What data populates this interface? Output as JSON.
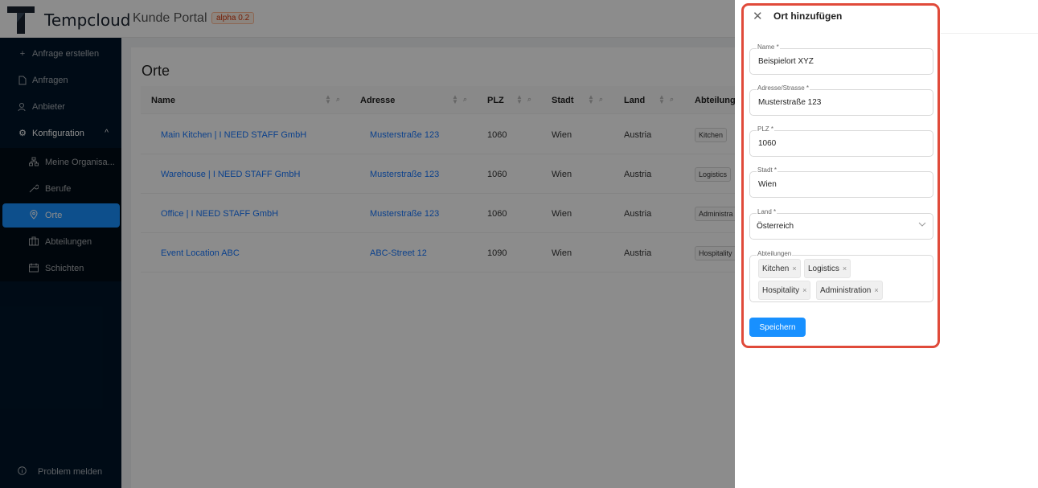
{
  "header": {
    "brand": "Tempcloud",
    "portal": "Kunde Portal",
    "version_badge": "alpha 0.2"
  },
  "sidebar": {
    "items": [
      {
        "label": "Anfrage erstellen",
        "icon": "plus-icon"
      },
      {
        "label": "Anfragen",
        "icon": "file-icon"
      },
      {
        "label": "Anbieter",
        "icon": "users-icon"
      },
      {
        "label": "Konfiguration",
        "icon": "gear-icon"
      }
    ],
    "sub_items": [
      {
        "label": "Meine Organisa...",
        "icon": "org-icon"
      },
      {
        "label": "Berufe",
        "icon": "wrench-icon"
      },
      {
        "label": "Orte",
        "icon": "location-icon"
      },
      {
        "label": "Abteilungen",
        "icon": "briefcase-icon"
      },
      {
        "label": "Schichten",
        "icon": "calendar-icon"
      }
    ],
    "footer": "Problem melden"
  },
  "page": {
    "title": "Orte",
    "columns": [
      "Name",
      "Adresse",
      "PLZ",
      "Stadt",
      "Land",
      "Abteilunge"
    ],
    "rows": [
      {
        "name": "Main Kitchen | I NEED STAFF GmbH",
        "address": "Musterstraße 123",
        "plz": "1060",
        "city": "Wien",
        "country": "Austria",
        "dept": "Kitchen"
      },
      {
        "name": "Warehouse | I NEED STAFF GmbH",
        "address": "Musterstraße 123",
        "plz": "1060",
        "city": "Wien",
        "country": "Austria",
        "dept": "Logistics"
      },
      {
        "name": "Office | I NEED STAFF GmbH",
        "address": "Musterstraße 123",
        "plz": "1060",
        "city": "Wien",
        "country": "Austria",
        "dept": "Administra"
      },
      {
        "name": "Event Location ABC",
        "address": "ABC-Street 12",
        "plz": "1090",
        "city": "Wien",
        "country": "Austria",
        "dept": "Hospitality"
      }
    ]
  },
  "drawer": {
    "title": "Ort hinzufügen",
    "fields": {
      "name": {
        "label": "Name *",
        "value": "Beispielort XYZ"
      },
      "address": {
        "label": "Adresse/Strasse *",
        "value": "Musterstraße 123"
      },
      "plz": {
        "label": "PLZ *",
        "value": "1060"
      },
      "city": {
        "label": "Stadt *",
        "value": "Wien"
      },
      "country": {
        "label": "Land *",
        "value": "Österreich"
      }
    },
    "departments": {
      "label": "Abteilungen",
      "tags": [
        "Kitchen",
        "Logistics",
        "Hospitality",
        "Administration"
      ]
    },
    "save_label": "Speichern"
  },
  "colors": {
    "sidebar_bg": "#001529",
    "accent": "#1890ff",
    "highlight": "#e04a3a"
  }
}
